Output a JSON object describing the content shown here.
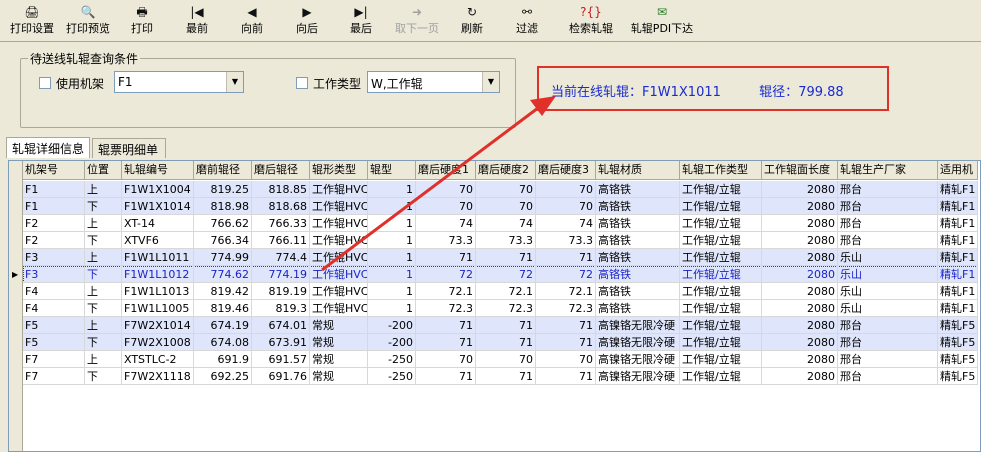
{
  "toolbar": {
    "buttons": [
      {
        "label": "打印设置",
        "icon": "printer-settings-icon"
      },
      {
        "label": "打印预览",
        "icon": "print-preview-icon"
      },
      {
        "label": "打印",
        "icon": "printer-icon"
      },
      {
        "label": "最前",
        "icon": "first-icon"
      },
      {
        "label": "向前",
        "icon": "prev-icon"
      },
      {
        "label": "向后",
        "icon": "next-icon"
      },
      {
        "label": "最后",
        "icon": "last-icon"
      },
      {
        "label": "取下一页",
        "icon": "next-page-icon"
      },
      {
        "label": "刷新",
        "icon": "refresh-icon"
      },
      {
        "label": "过滤",
        "icon": "binoculars-icon"
      },
      {
        "label": "检索轧辊",
        "icon": "search-roll-icon"
      },
      {
        "label": "轧辊PDI下达",
        "icon": "pdi-issue-icon"
      }
    ]
  },
  "query": {
    "title": "待送线轧辊查询条件",
    "use_stand_label": "使用机架",
    "stand_value": "F1",
    "work_type_label": "工作类型",
    "work_type_value": "W,工作辊"
  },
  "highlight": {
    "current_roll_label": "当前在线轧辊：",
    "current_roll_value": "F1W1X1011",
    "diameter_label": "辊径：",
    "diameter_value": "799.88",
    "color": "#e0302a"
  },
  "tabs": [
    {
      "label": "轧辊详细信息"
    },
    {
      "label": "辊票明细单"
    }
  ],
  "table": {
    "headers": [
      "机架号",
      "位置",
      "轧辊编号",
      "磨前辊径",
      "磨后辊径",
      "辊形类型",
      "辊型",
      "磨后硬度1",
      "磨后硬度2",
      "磨后硬度3",
      "轧辊材质",
      "轧辊工作类型",
      "工作辊面长度",
      "轧辊生产厂家",
      "适用机"
    ],
    "rows": [
      [
        "F1",
        "上",
        "F1W1X1004",
        "819.25",
        "818.85",
        "工作辊HVC",
        "1",
        "70",
        "70",
        "70",
        "高铬铁",
        "工作辊/立辊",
        "2080",
        "邢台",
        "精轧F1"
      ],
      [
        "F1",
        "下",
        "F1W1X1014",
        "818.98",
        "818.68",
        "工作辊HVC",
        "1",
        "70",
        "70",
        "70",
        "高铬铁",
        "工作辊/立辊",
        "2080",
        "邢台",
        "精轧F1"
      ],
      [
        "F2",
        "上",
        "XT-14",
        "766.62",
        "766.33",
        "工作辊HVC",
        "1",
        "74",
        "74",
        "74",
        "高铬铁",
        "工作辊/立辊",
        "2080",
        "邢台",
        "精轧F1"
      ],
      [
        "F2",
        "下",
        "XTVF6",
        "766.34",
        "766.11",
        "工作辊HVC",
        "1",
        "73.3",
        "73.3",
        "73.3",
        "高铬铁",
        "工作辊/立辊",
        "2080",
        "邢台",
        "精轧F1"
      ],
      [
        "F3",
        "上",
        "F1W1L1011",
        "774.99",
        "774.4",
        "工作辊HVC",
        "1",
        "71",
        "71",
        "71",
        "高铬铁",
        "工作辊/立辊",
        "2080",
        "乐山",
        "精轧F1"
      ],
      [
        "F3",
        "下",
        "F1W1L1012",
        "774.62",
        "774.19",
        "工作辊HVC",
        "1",
        "72",
        "72",
        "72",
        "高铬铁",
        "工作辊/立辊",
        "2080",
        "乐山",
        "精轧F1"
      ],
      [
        "F4",
        "上",
        "F1W1L1013",
        "819.42",
        "819.19",
        "工作辊HVC",
        "1",
        "72.1",
        "72.1",
        "72.1",
        "高铬铁",
        "工作辊/立辊",
        "2080",
        "乐山",
        "精轧F1"
      ],
      [
        "F4",
        "下",
        "F1W1L1005",
        "819.46",
        "819.3",
        "工作辊HVC",
        "1",
        "72.3",
        "72.3",
        "72.3",
        "高铬铁",
        "工作辊/立辊",
        "2080",
        "乐山",
        "精轧F1"
      ],
      [
        "F5",
        "上",
        "F7W2X1014",
        "674.19",
        "674.01",
        "常规",
        "-200",
        "71",
        "71",
        "71",
        "高镍铬无限冷硬",
        "工作辊/立辊",
        "2080",
        "邢台",
        "精轧F5"
      ],
      [
        "F5",
        "下",
        "F7W2X1008",
        "674.08",
        "673.91",
        "常规",
        "-200",
        "71",
        "71",
        "71",
        "高镍铬无限冷硬",
        "工作辊/立辊",
        "2080",
        "邢台",
        "精轧F5"
      ],
      [
        "F7",
        "上",
        "XTSTLC-2",
        "691.9",
        "691.57",
        "常规",
        "-250",
        "70",
        "70",
        "70",
        "高镍铬无限冷硬",
        "工作辊/立辊",
        "2080",
        "邢台",
        "精轧F5"
      ],
      [
        "F7",
        "下",
        "F7W2X1118",
        "692.25",
        "691.76",
        "常规",
        "-250",
        "71",
        "71",
        "71",
        "高镍铬无限冷硬",
        "工作辊/立辊",
        "2080",
        "邢台",
        "精轧F5"
      ]
    ]
  }
}
